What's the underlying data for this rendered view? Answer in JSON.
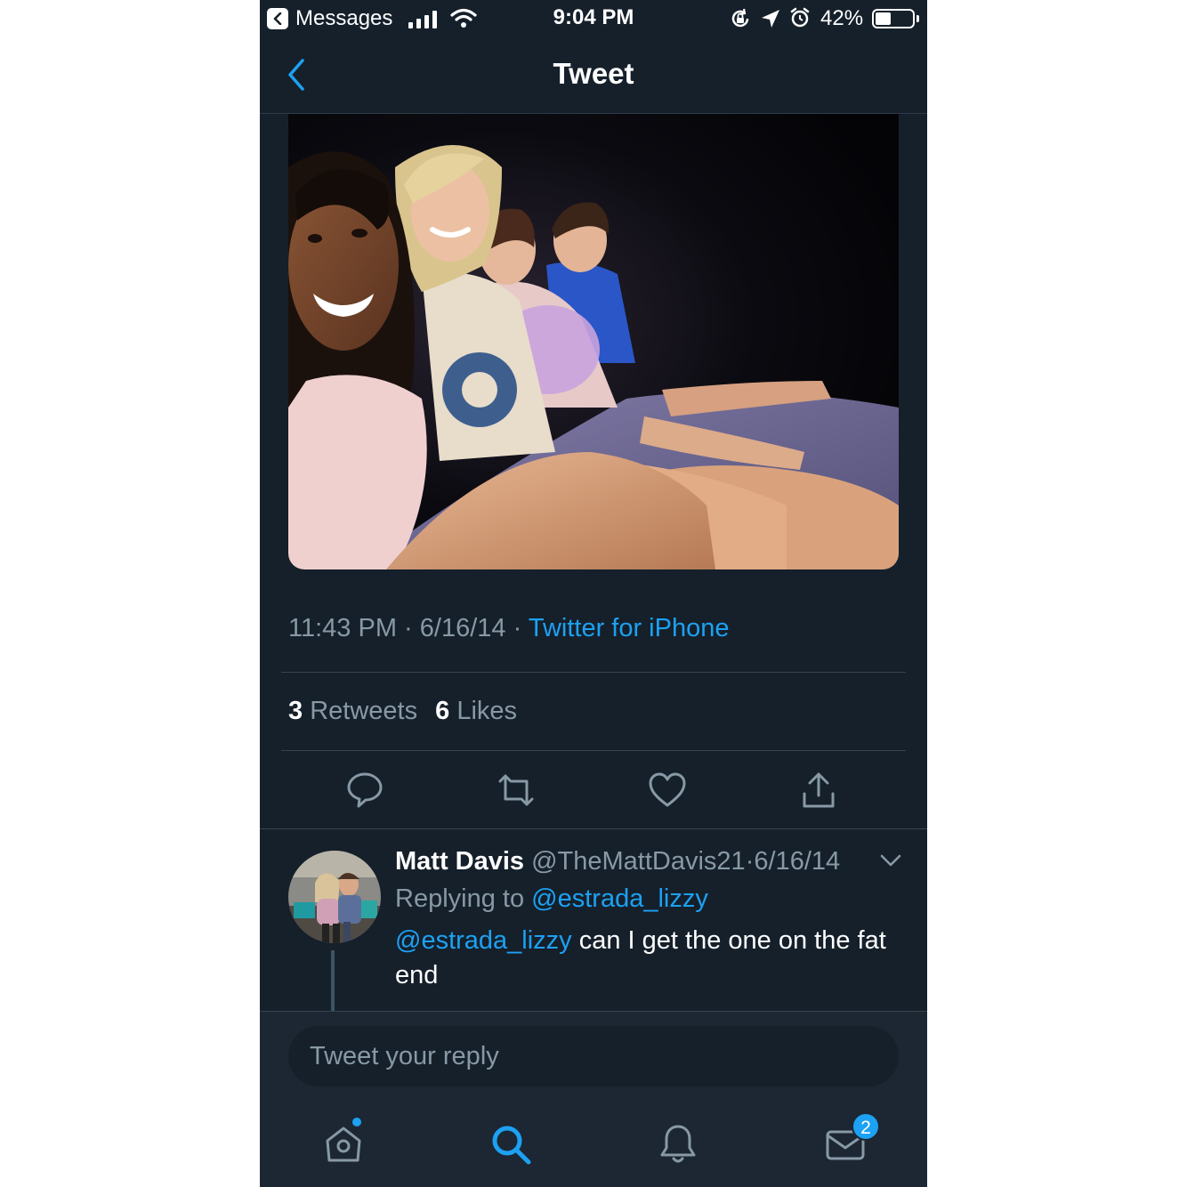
{
  "status_bar": {
    "back_app": "Messages",
    "time": "9:04 PM",
    "battery_percent": "42%",
    "battery_level": 0.42
  },
  "nav": {
    "title": "Tweet"
  },
  "tweet": {
    "time": "11:43 PM",
    "date": "6/16/14",
    "separator": "·",
    "source": "Twitter for iPhone",
    "retweets_count": "3",
    "retweets_label": "Retweets",
    "likes_count": "6",
    "likes_label": "Likes"
  },
  "reply": {
    "name": "Matt Davis",
    "handle": "@TheMattDavis21",
    "date": "6/16/14",
    "replying_prefix": "Replying to",
    "replying_to": "@estrada_lizzy",
    "mention": "@estrada_lizzy",
    "text": " can I get the one on the fat end"
  },
  "composer": {
    "placeholder": "Tweet your reply"
  },
  "tab_bar": {
    "messages_badge": "2"
  },
  "colors": {
    "background": "#15202b",
    "accent": "#1da1f2",
    "secondary_text": "#8899a6",
    "divider": "#38444d"
  },
  "icons": {
    "actions": [
      "reply-icon",
      "retweet-icon",
      "like-icon",
      "share-icon"
    ],
    "tabs": [
      "home-icon",
      "search-icon",
      "notifications-icon",
      "messages-icon"
    ]
  }
}
